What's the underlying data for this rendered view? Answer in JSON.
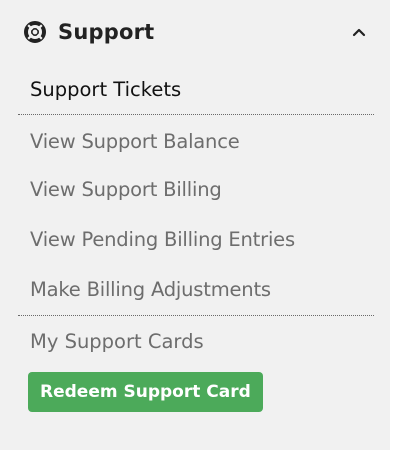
{
  "header": {
    "icon": "life-ring-icon",
    "title": "Support",
    "toggle_icon": "chevron-up-icon"
  },
  "section": {
    "title": "Support Tickets"
  },
  "menu": {
    "items": [
      {
        "label": "View Support Balance"
      },
      {
        "label": "View Support Billing"
      },
      {
        "label": "View Pending Billing Entries"
      },
      {
        "label": "Make Billing Adjustments"
      }
    ]
  },
  "cards": {
    "link_label": "My Support Cards",
    "redeem_label": "Redeem Support Card"
  },
  "colors": {
    "panel_bg": "#f1f1f1",
    "link_text": "#6d6d6d",
    "button_bg": "#4caa5a"
  }
}
